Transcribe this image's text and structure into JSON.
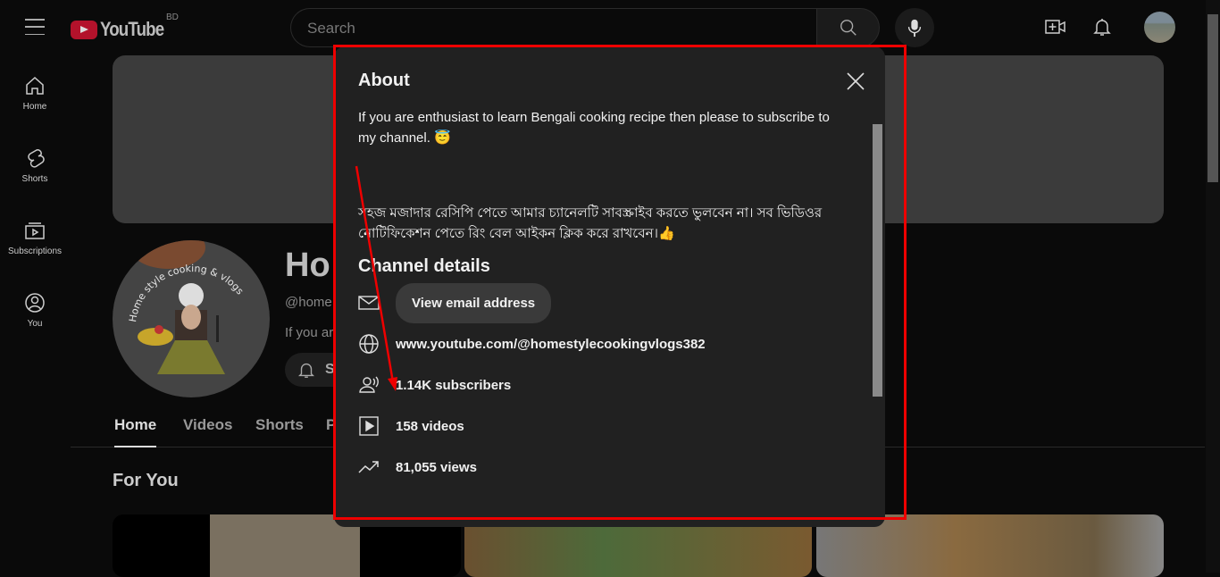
{
  "header": {
    "logo": "YouTube",
    "country": "BD",
    "search_placeholder": "Search"
  },
  "sidebar": {
    "items": [
      {
        "label": "Home"
      },
      {
        "label": "Shorts"
      },
      {
        "label": "Subscriptions"
      },
      {
        "label": "You"
      }
    ]
  },
  "channel": {
    "name_visible": "Ho",
    "handle_visible": "@home",
    "desc_visible": "If you ar",
    "subscribe_visible": "S",
    "avatar_text": "Home style cooking & vlogs",
    "tabs": [
      {
        "label": "Home"
      },
      {
        "label": "Videos"
      },
      {
        "label": "Shorts"
      },
      {
        "label": "P"
      }
    ],
    "section": "For You"
  },
  "about": {
    "title": "About",
    "description_en": "If you are enthusiast to learn Bengali cooking recipe then please to subscribe to my channel. 😇",
    "description_bn": "সহজ মজাদার রেসিপি পেতে আমার চ্যানেলটি সাবস্ক্রাইব করতে ভুলবেন না। সব ভিডিওর নোটিফিকেশন পেতে রিং বেল আইকন ক্লিক করে রাখবেন।👍",
    "details_title": "Channel details",
    "email_button": "View email address",
    "url": "www.youtube.com/@homestylecookingvlogs382",
    "subscribers": "1.14K subscribers",
    "videos": "158 videos",
    "views": "81,055 views"
  },
  "colors": {
    "annotation": "#e00000",
    "logo_red": "#b3122b"
  }
}
